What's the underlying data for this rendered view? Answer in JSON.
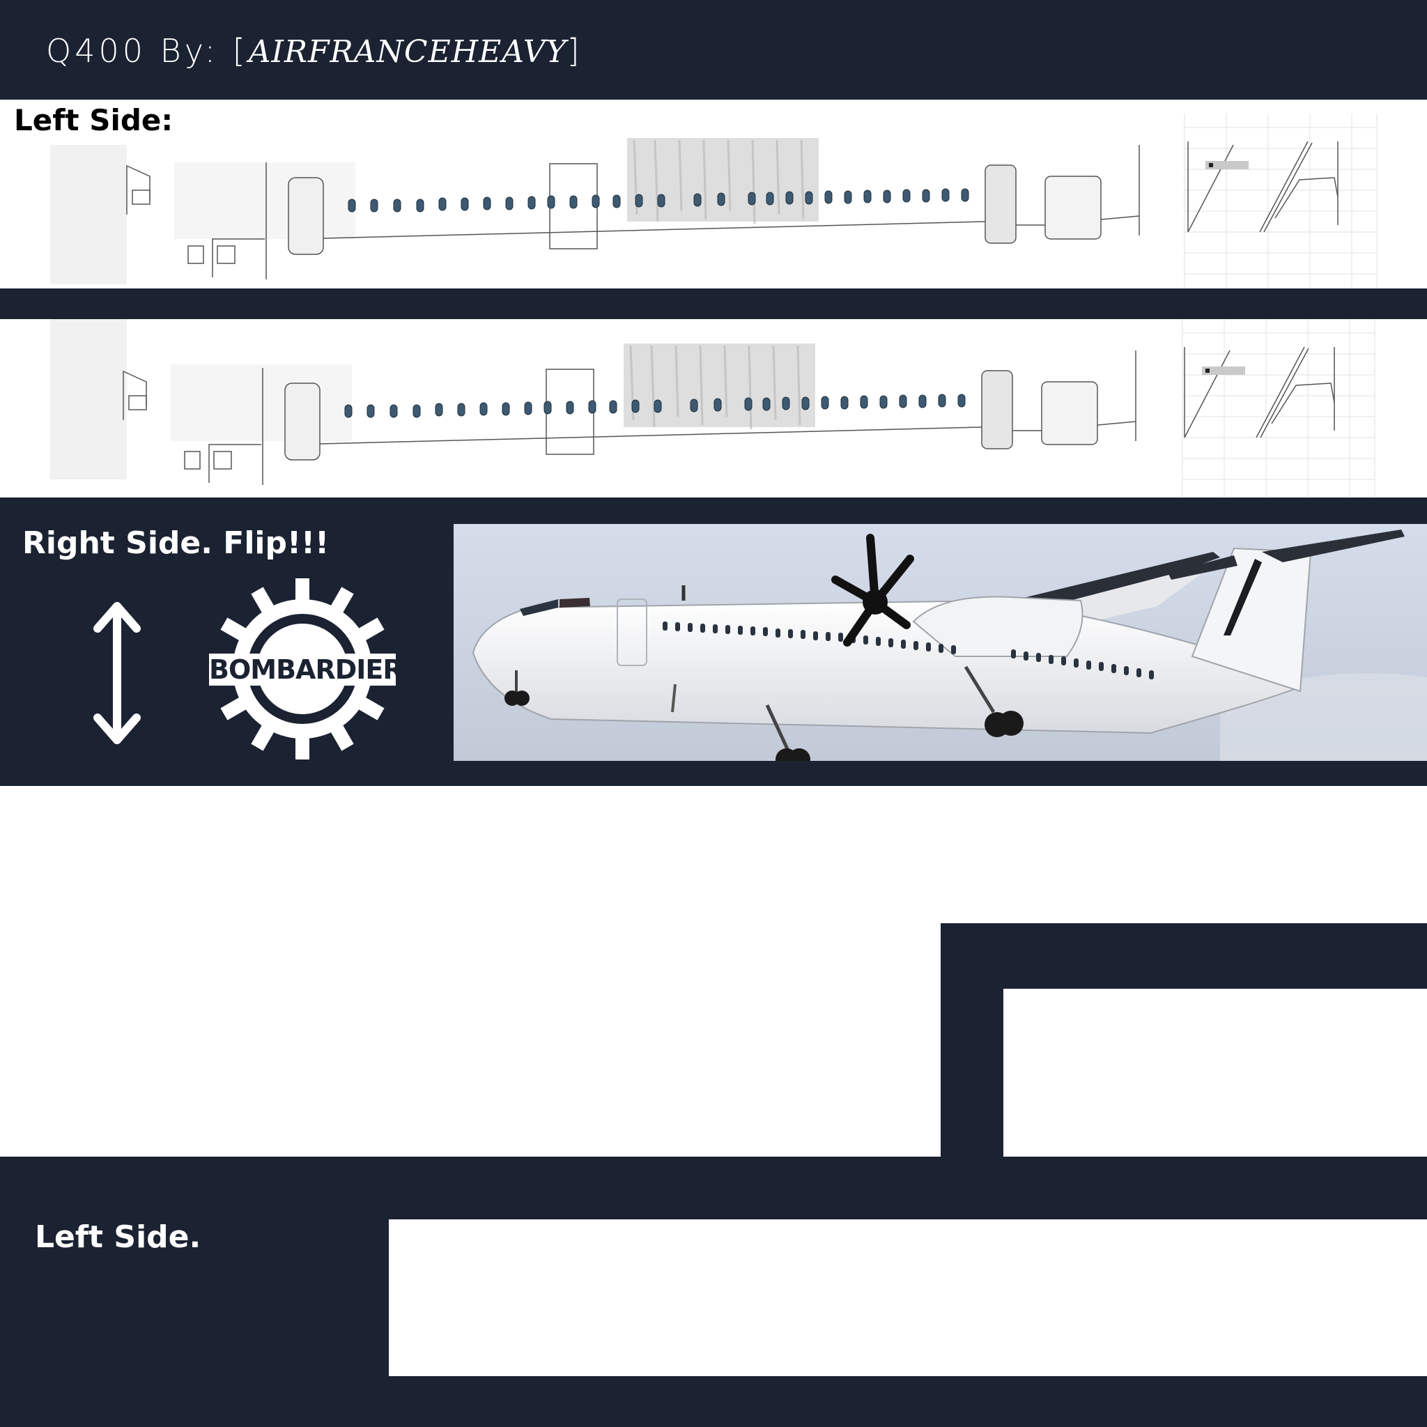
{
  "header": {
    "title_prefix": "Q400 By: [",
    "author": "AIRFRANCEHEAVY",
    "title_suffix": "]"
  },
  "labels": {
    "left_side_top": "Left Side:",
    "right_side_flip": "Right Side. Flip!!!",
    "left_side_bottom": "Left Side."
  },
  "logo": {
    "text": "BOMBARDIER"
  },
  "icons": {
    "flip": "vertical-double-arrow-icon",
    "logo": "bombardier-gear-logo",
    "photo": "q400-aircraft-photo"
  },
  "colors": {
    "navy": "#1b2232",
    "white": "#ffffff",
    "window_blue": "#3d5a72",
    "sky": "#cfd6e2"
  }
}
